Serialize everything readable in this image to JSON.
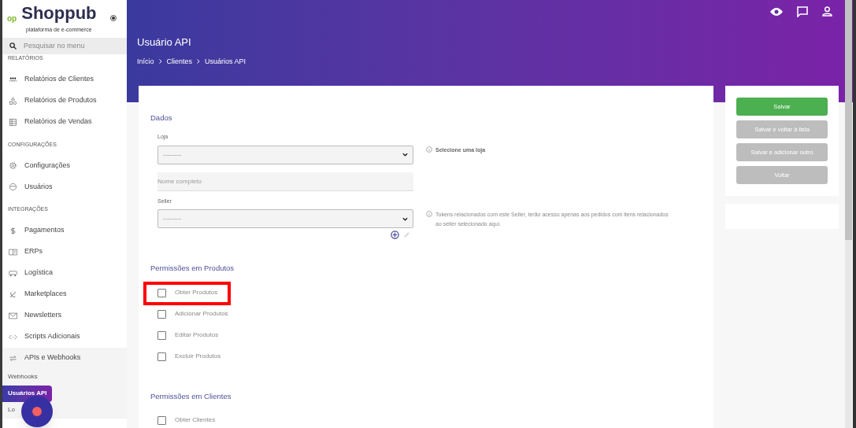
{
  "sidebar": {
    "logo": {
      "mark": "op",
      "name": "Shoppub",
      "tagline": "plataforma de e-commerce"
    },
    "search": {
      "placeholder": "Pesquisar no menu"
    },
    "sections": [
      {
        "title": "RELATÓRIOS",
        "items": [
          {
            "label": "Relatórios de Clientes"
          },
          {
            "label": "Relatórios de Produtos"
          },
          {
            "label": "Relatórios de Vendas"
          }
        ]
      },
      {
        "title": "CONFIGURAÇÕES",
        "items": [
          {
            "label": "Configurações"
          },
          {
            "label": "Usuários"
          }
        ]
      },
      {
        "title": "INTEGRAÇÕES",
        "items": [
          {
            "label": "Pagamentos"
          },
          {
            "label": "ERPs"
          },
          {
            "label": "Logística"
          },
          {
            "label": "Marketplaces"
          },
          {
            "label": "Newsletters"
          },
          {
            "label": "Scripts Adicionais"
          },
          {
            "label": "APIs e Webhooks",
            "expanded": true,
            "children": [
              {
                "label": "Webhooks",
                "selected": false
              },
              {
                "label": "Usuários API",
                "selected": true
              },
              {
                "label": "Lo",
                "selected": false
              }
            ]
          }
        ]
      }
    ]
  },
  "header": {
    "title": "Usuário API",
    "breadcrumb": [
      "Início",
      "Clientes",
      "Usuários API"
    ]
  },
  "form": {
    "sections": [
      {
        "title": "Dados",
        "fields": [
          {
            "kind": "select",
            "label": "Loja",
            "value": "----------",
            "hint": "Selecione uma loja",
            "hint_bold": true
          },
          {
            "kind": "text",
            "placeholder": "Nome completo"
          },
          {
            "kind": "select",
            "label": "Seller",
            "value": "----------",
            "hint": "Tokens relacionados com este Seller, terão acesso apenas aos pedidos com itens relacionados ao seller selecionado aqui.",
            "hint_bold": false,
            "actions": true
          }
        ]
      },
      {
        "title": "Permissões em Produtos",
        "checkboxes": [
          {
            "label": "Obter Produtos",
            "checked": false,
            "highlighted": true
          },
          {
            "label": "Adicionar Produtos",
            "checked": false,
            "highlighted": false
          },
          {
            "label": "Editar Produtos",
            "checked": false,
            "highlighted": false
          },
          {
            "label": "Excluir Produtos",
            "checked": false,
            "highlighted": false
          }
        ]
      },
      {
        "title": "Permissões em Clientes",
        "checkboxes": [
          {
            "label": "Obter Clientes",
            "checked": false,
            "highlighted": false
          }
        ]
      }
    ]
  },
  "actions": [
    {
      "label": "Salvar",
      "primary": true
    },
    {
      "label": "Salvar e voltar à lista",
      "primary": false
    },
    {
      "label": "Salvar e adicionar outro",
      "primary": false
    },
    {
      "label": "Voltar",
      "primary": false
    }
  ]
}
